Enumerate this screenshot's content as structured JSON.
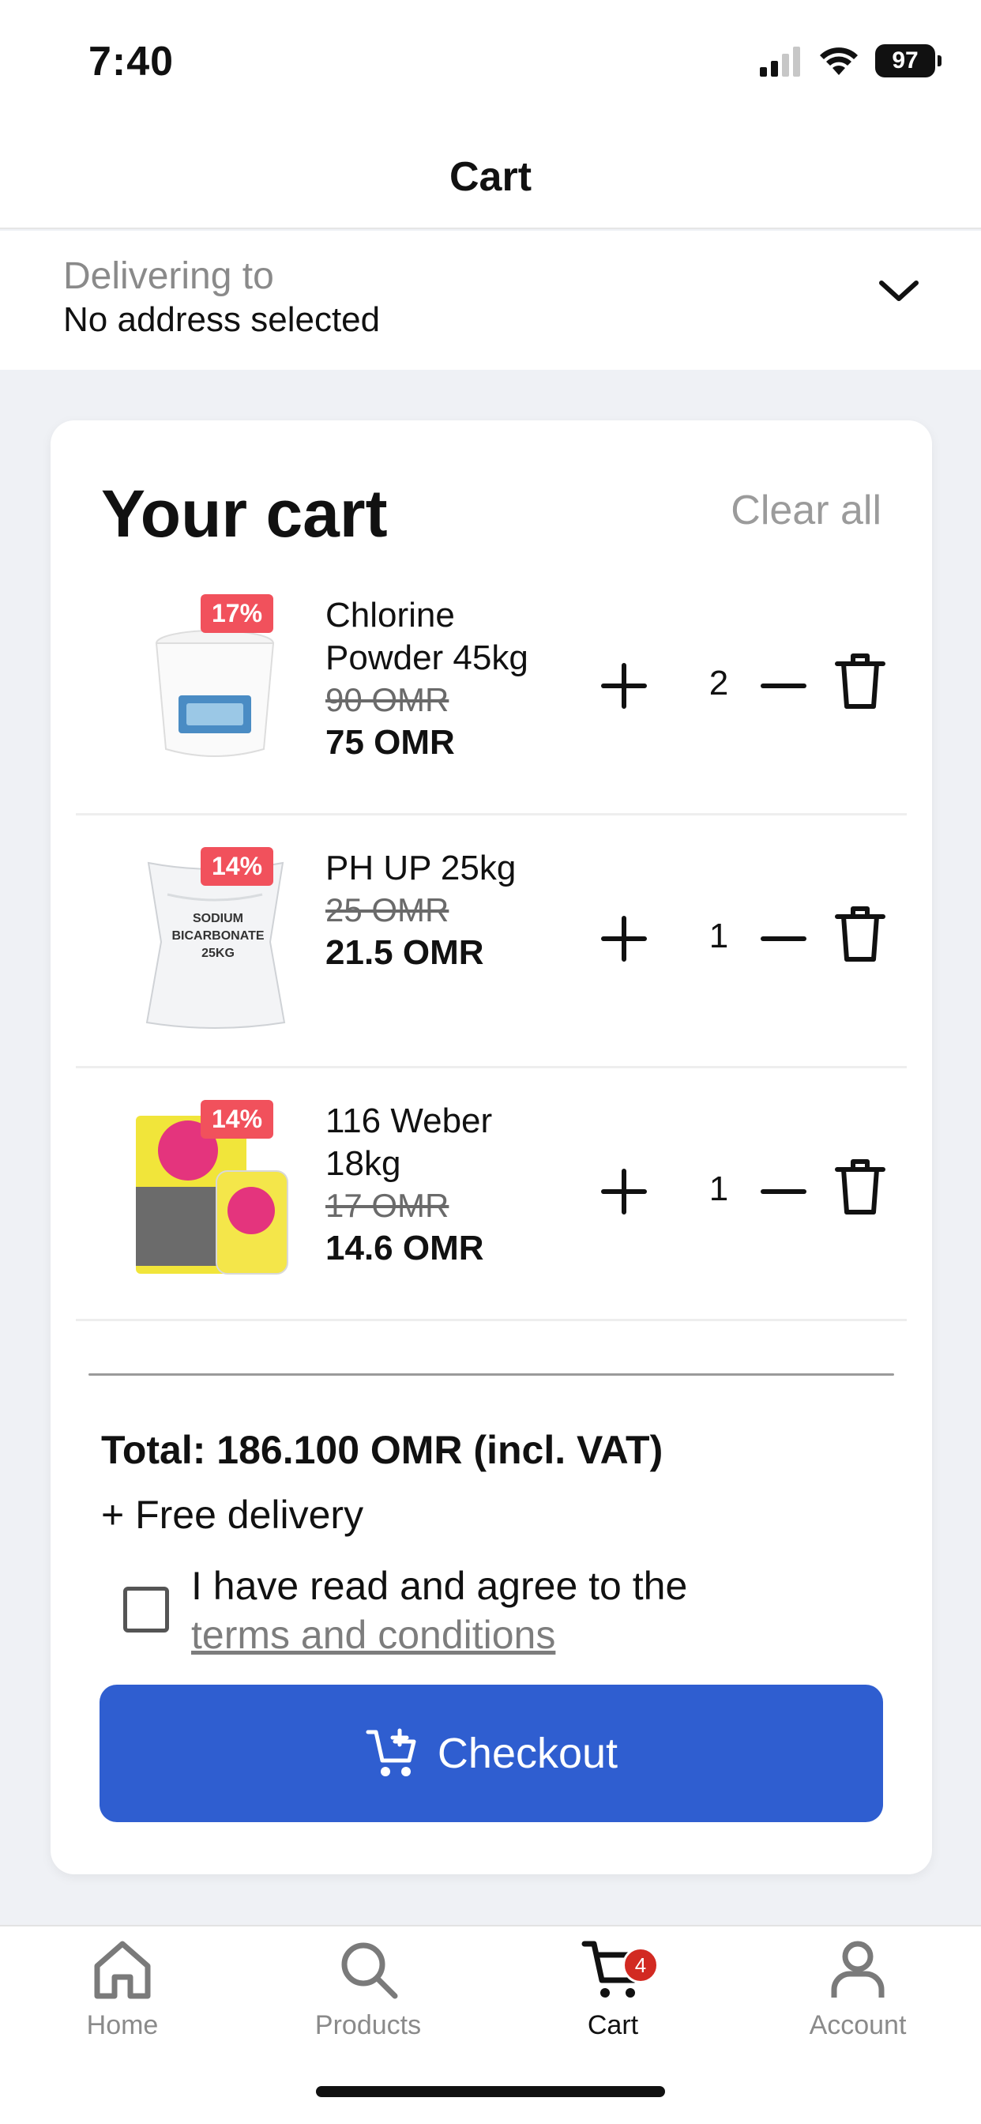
{
  "status_bar": {
    "time": "7:40",
    "battery": "97"
  },
  "header": {
    "title": "Cart"
  },
  "address": {
    "label": "Delivering to",
    "value": "No address selected"
  },
  "cart": {
    "title": "Your cart",
    "clear_all": "Clear all",
    "items": [
      {
        "name": "Chlorine Powder 45kg",
        "old_price": "90 OMR",
        "price": "75 OMR",
        "qty": "2",
        "discount": "17%",
        "thumb_text": ""
      },
      {
        "name": "PH UP 25kg",
        "old_price": "25 OMR",
        "price": "21.5 OMR",
        "qty": "1",
        "discount": "14%",
        "thumb_text": "SODIUM BICARBONATE 25KG"
      },
      {
        "name": "116 Weber 18kg",
        "old_price": "17 OMR",
        "price": "14.6 OMR",
        "qty": "1",
        "discount": "14%",
        "thumb_text": ""
      }
    ],
    "total": "Total: 186.100 OMR (incl. VAT)",
    "delivery": "+ Free delivery",
    "terms_prefix": "I have read and agree to the",
    "terms_link": "terms and conditions",
    "checkout": "Checkout"
  },
  "tabs": [
    {
      "label": "Home",
      "icon": "home-icon"
    },
    {
      "label": "Products",
      "icon": "search-icon"
    },
    {
      "label": "Cart",
      "icon": "cart-icon",
      "badge": "4",
      "active": true
    },
    {
      "label": "Account",
      "icon": "user-icon"
    }
  ],
  "colors": {
    "accent": "#2f5ed0",
    "discount": "#f1515c",
    "badge": "#d22a22"
  }
}
